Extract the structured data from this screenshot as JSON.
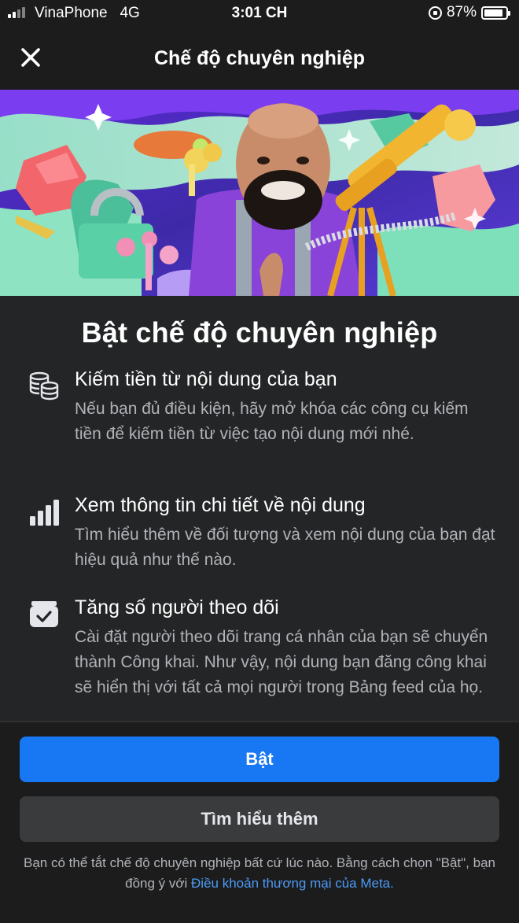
{
  "status_bar": {
    "carrier": "VinaPhone",
    "network": "4G",
    "time": "3:01 CH",
    "battery": "87%",
    "battery_level": 0.87
  },
  "nav": {
    "title": "Chế độ chuyên nghiệp",
    "close_icon": "close-icon"
  },
  "hero": {
    "icon": "hero-illustration"
  },
  "main": {
    "title": "Bật chế độ chuyên nghiệp",
    "features": [
      {
        "icon": "coins-stack-icon",
        "title": "Kiếm tiền từ nội dung của bạn",
        "description": "Nếu bạn đủ điều kiện, hãy mở khóa các công cụ kiếm tiền để kiếm tiền từ việc tạo nội dung mới nhé."
      },
      {
        "icon": "bar-chart-icon",
        "title": "Xem thông tin chi tiết về nội dung",
        "description": "Tìm hiểu thêm về đối tượng và xem nội dung của bạn đạt hiệu quả như thế nào."
      },
      {
        "icon": "inbox-check-icon",
        "title": "Tăng số người theo dõi",
        "description": "Cài đặt người theo dõi trang cá nhân của bạn sẽ chuyển thành Công khai. Như vậy, nội dung bạn đăng công khai sẽ hiển thị với tất cả mọi người trong Bảng feed của họ."
      }
    ]
  },
  "actions": {
    "primary_label": "Bật",
    "secondary_label": "Tìm hiểu thêm"
  },
  "legal": {
    "text": "Bạn có thể tắt chế độ chuyên nghiệp bất cứ lúc nào. Bằng cách chọn \"Bật\", bạn đồng ý với ",
    "link_text": "Điều khoản thương mại của Meta."
  },
  "colors": {
    "primary": "#1877f2",
    "background": "#1c1c1d",
    "card": "#242526",
    "link": "#4b9bf5"
  }
}
